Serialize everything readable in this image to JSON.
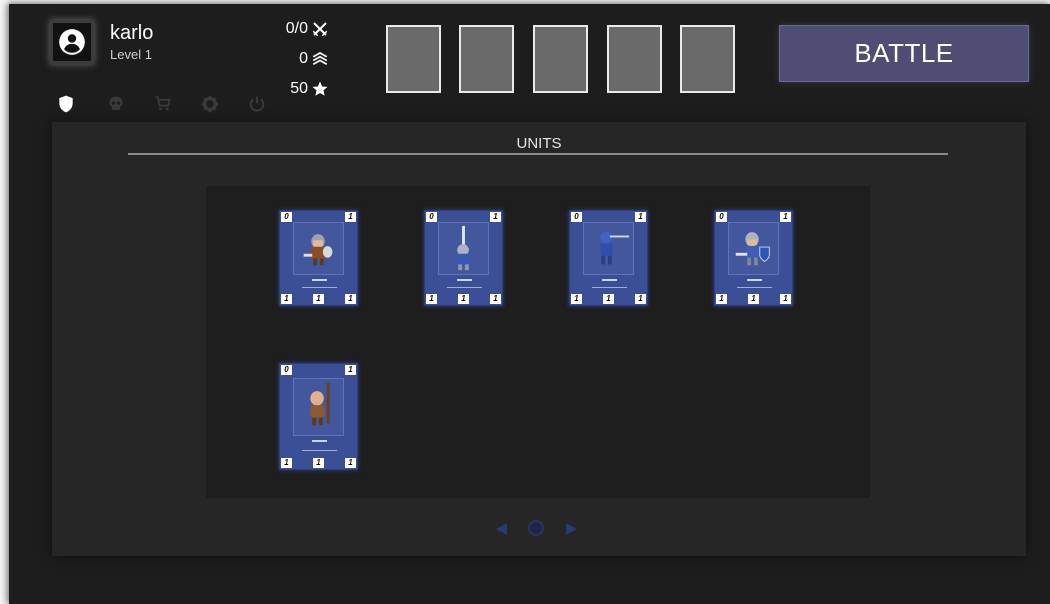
{
  "player": {
    "name": "karlo",
    "level": "Level 1"
  },
  "nav": [
    {
      "name": "shield-icon",
      "active": true
    },
    {
      "name": "skull-icon",
      "active": false
    },
    {
      "name": "cart-icon",
      "active": false
    },
    {
      "name": "gear-icon",
      "active": false
    },
    {
      "name": "power-icon",
      "active": false
    }
  ],
  "stats": {
    "battles": "0/0",
    "battles_icon": "crossed-swords-icon",
    "rank": "0",
    "rank_icon": "rank-chevrons-icon",
    "stars": "50",
    "stars_icon": "star-icon"
  },
  "deck_slots": 5,
  "battle_button": "BATTLE",
  "units_panel": {
    "title": "UNITS",
    "cards": [
      {
        "unit": "helmeted-axe-warrior",
        "top_left": "0",
        "top_right": "1",
        "bottom": [
          "1",
          "1",
          "1"
        ]
      },
      {
        "unit": "sword-knight",
        "top_left": "0",
        "top_right": "1",
        "bottom": [
          "1",
          "1",
          "1"
        ]
      },
      {
        "unit": "spear-knight",
        "top_left": "0",
        "top_right": "1",
        "bottom": [
          "1",
          "1",
          "1"
        ]
      },
      {
        "unit": "sword-and-shield-knight",
        "top_left": "0",
        "top_right": "1",
        "bottom": [
          "1",
          "1",
          "1"
        ]
      },
      {
        "unit": "staff-peasant",
        "top_left": "0",
        "top_right": "1",
        "bottom": [
          "1",
          "1",
          "1"
        ]
      }
    ]
  },
  "colors": {
    "background": "#1d1d1d",
    "panel": "#262626",
    "card": "#3a4f96",
    "battle_button": "#4f4d73",
    "slot": "#6a6a6a"
  }
}
